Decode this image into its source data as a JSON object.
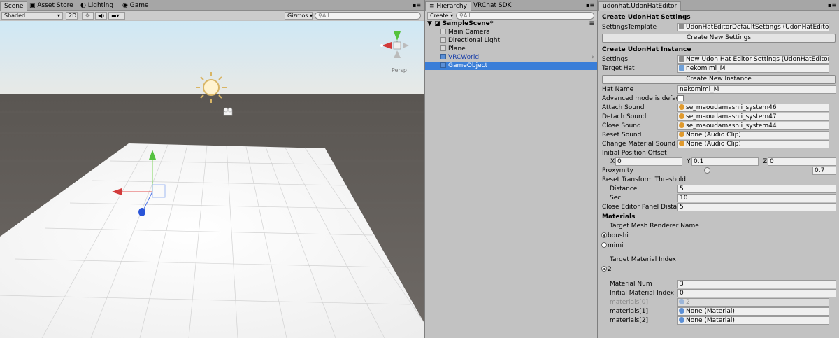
{
  "scene": {
    "tabs": [
      "Scene",
      "Asset Store",
      "Lighting",
      "Game"
    ],
    "shading_mode": "Shaded",
    "mode_2d": "2D",
    "gizmos": "Gizmos",
    "search_placeholder": "All",
    "persp_label": "Persp"
  },
  "hierarchy": {
    "tabs": [
      "Hierarchy",
      "VRChat SDK"
    ],
    "create_label": "Create",
    "search_placeholder": "All",
    "scene_name": "SampleScene*",
    "items": [
      "Main Camera",
      "Directional Light",
      "Plane",
      "VRCWorld",
      "GameObject"
    ]
  },
  "inspector": {
    "tab": "udonhat.UdonHatEditor",
    "create_settings_header": "Create UdonHat Settings",
    "settings_template_label": "SettingsTemplate",
    "settings_template_value": "UdonHatEditorDefaultSettings (UdonHatEditorSe",
    "create_new_settings": "Create New Settings",
    "create_instance_header": "Create UdonHat Instance",
    "settings_label": "Settings",
    "settings_value": "New Udon Hat Editor Settings (UdonHatEditorSe",
    "target_hat_label": "Target Hat",
    "target_hat_value": "nekomimi_M",
    "create_new_instance": "Create New Instance",
    "hat_name_label": "Hat Name",
    "hat_name_value": "nekomimi_M",
    "advanced_mode_label": "Advanced mode is default",
    "attach_sound_label": "Attach Sound",
    "attach_sound_value": "se_maoudamashii_system46",
    "detach_sound_label": "Detach Sound",
    "detach_sound_value": "se_maoudamashii_system47",
    "close_sound_label": "Close Sound",
    "close_sound_value": "se_maoudamashii_system44",
    "reset_sound_label": "Reset Sound",
    "reset_sound_value": "None (Audio Clip)",
    "change_material_sound_label": "Change Material Sound",
    "change_material_sound_value": "None (Audio Clip)",
    "initial_position_offset_label": "Initial Position Offset",
    "offset_x_label": "X",
    "offset_x": "0",
    "offset_y_label": "Y",
    "offset_y": "0.1",
    "offset_z_label": "Z",
    "offset_z": "0",
    "proxymity_label": "Proxymity",
    "proxymity_value": "0.7",
    "proxymity_level": 0.7,
    "reset_threshold_label": "Reset Transform Threshold",
    "distance_label": "Distance",
    "distance_value": "5",
    "sec_label": "Sec",
    "sec_value": "10",
    "close_distance_label": "Close Editor Panel Distanc",
    "close_distance_value": "5",
    "materials_header": "Materials",
    "target_mesh_label": "Target Mesh Renderer Name",
    "mesh_option_1": "boushi",
    "mesh_option_2": "mimi",
    "target_material_index_label": "Target Material Index",
    "material_index_option": "2",
    "material_num_label": "Material Num",
    "material_num_value": "3",
    "initial_material_index_label": "Initial Material Index",
    "initial_material_index_value": "0",
    "materials0_label": "materials[0]",
    "materials0_value": "2",
    "materials1_label": "materials[1]",
    "materials1_value": "None (Material)",
    "materials2_label": "materials[2]",
    "materials2_value": "None (Material)"
  },
  "colors": {
    "selection": "#3a7ed8",
    "sky": "#d8ecf6",
    "ground": "#6e6965",
    "plane": "#f4f4f4"
  }
}
